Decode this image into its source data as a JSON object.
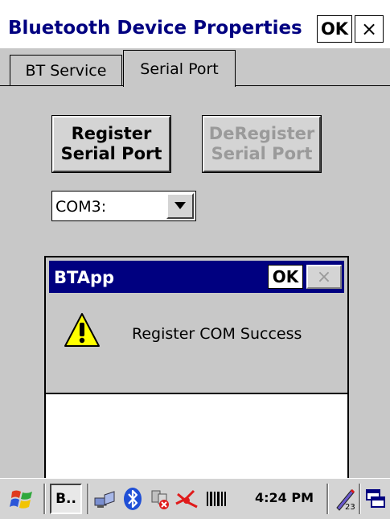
{
  "window": {
    "title": "Bluetooth Device Properties",
    "ok_label": "OK",
    "close_label": "×"
  },
  "tabs": [
    {
      "label": "BT Service",
      "active": false
    },
    {
      "label": "Serial Port",
      "active": true
    }
  ],
  "buttons": {
    "register_line1": "Register",
    "register_line2": "Serial Port",
    "deregister_line1": "DeRegister",
    "deregister_line2": "Serial Port"
  },
  "com_port": {
    "selected": "COM3:"
  },
  "dialog": {
    "title": "BTApp",
    "ok_label": "OK",
    "close_label": "×",
    "message": "Register COM Success",
    "icon": "warning-icon"
  },
  "taskbar": {
    "task_label": "B..",
    "time": "4:24 PM",
    "icons": [
      "start-icon",
      "network-icon",
      "bluetooth-icon",
      "no-connection-icon",
      "signal-icon",
      "barcode-icon",
      "input-method-icon",
      "window-switch-icon"
    ]
  },
  "colors": {
    "title_text": "#000080",
    "dialog_titlebar": "#000080",
    "background": "#c8c8c8",
    "disabled_text": "#9a9a9a"
  }
}
